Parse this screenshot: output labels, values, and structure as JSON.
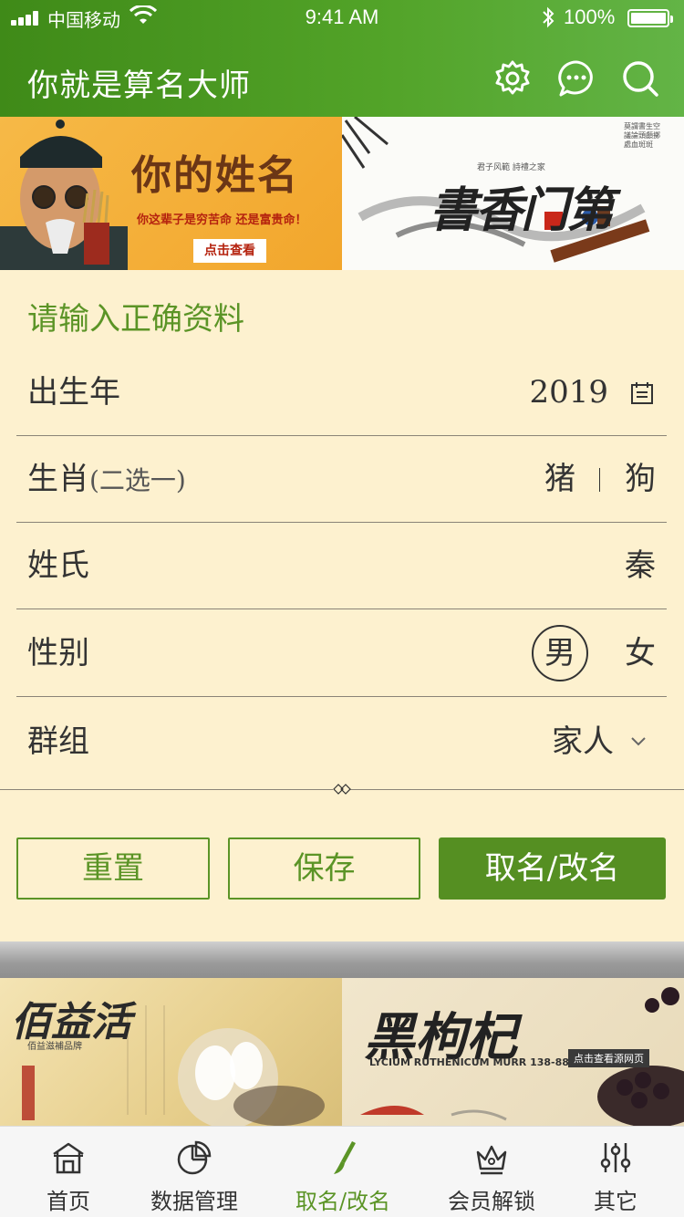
{
  "status_bar": {
    "carrier": "中国移动",
    "time": "9:41 AM",
    "battery": "100%"
  },
  "header": {
    "title": "你就是算名大师",
    "icons": [
      "settings-icon",
      "chat-icon",
      "search-icon"
    ]
  },
  "banners_top": [
    {
      "title": "你的姓名",
      "subtitle": "你这辈子是穷苦命 还是富贵命！",
      "button": "点击查看"
    },
    {
      "title": "書香门第",
      "subtitle": "君子风範 詩禮之家",
      "side_text": "莫謂書生空議論頭顱擲處血斑斑"
    }
  ],
  "form": {
    "title": "请输入正确资料",
    "birth_year": {
      "label": "出生年",
      "value": "2019"
    },
    "zodiac": {
      "label": "生肖",
      "hint": "(二选一)",
      "options": [
        "猪",
        "狗"
      ]
    },
    "surname": {
      "label": "姓氏",
      "value": "秦"
    },
    "gender": {
      "label": "性别",
      "options": [
        "男",
        "女"
      ],
      "selected": "男"
    },
    "group": {
      "label": "群组",
      "value": "家人"
    }
  },
  "buttons": {
    "reset": "重置",
    "save": "保存",
    "naming": "取名/改名"
  },
  "banners_bottom": [
    {
      "title": "佰益活",
      "subtitle": "佰益滋補品牌"
    },
    {
      "title": "黑枸杞",
      "subtitle": "LYCIUM RUTHENICUM MURR 138-88866168",
      "tag": "点击查看源网页"
    }
  ],
  "tabbar": {
    "items": [
      {
        "label": "首页",
        "icon": "home-icon"
      },
      {
        "label": "数据管理",
        "icon": "pie-chart-icon"
      },
      {
        "label": "取名/改名",
        "icon": "brush-icon"
      },
      {
        "label": "会员解锁",
        "icon": "crown-icon"
      },
      {
        "label": "其它",
        "icon": "sliders-icon"
      }
    ],
    "active_index": 2
  },
  "colors": {
    "brand": "#558f22",
    "header": "#4a9a22",
    "background": "#fdf1cf"
  }
}
